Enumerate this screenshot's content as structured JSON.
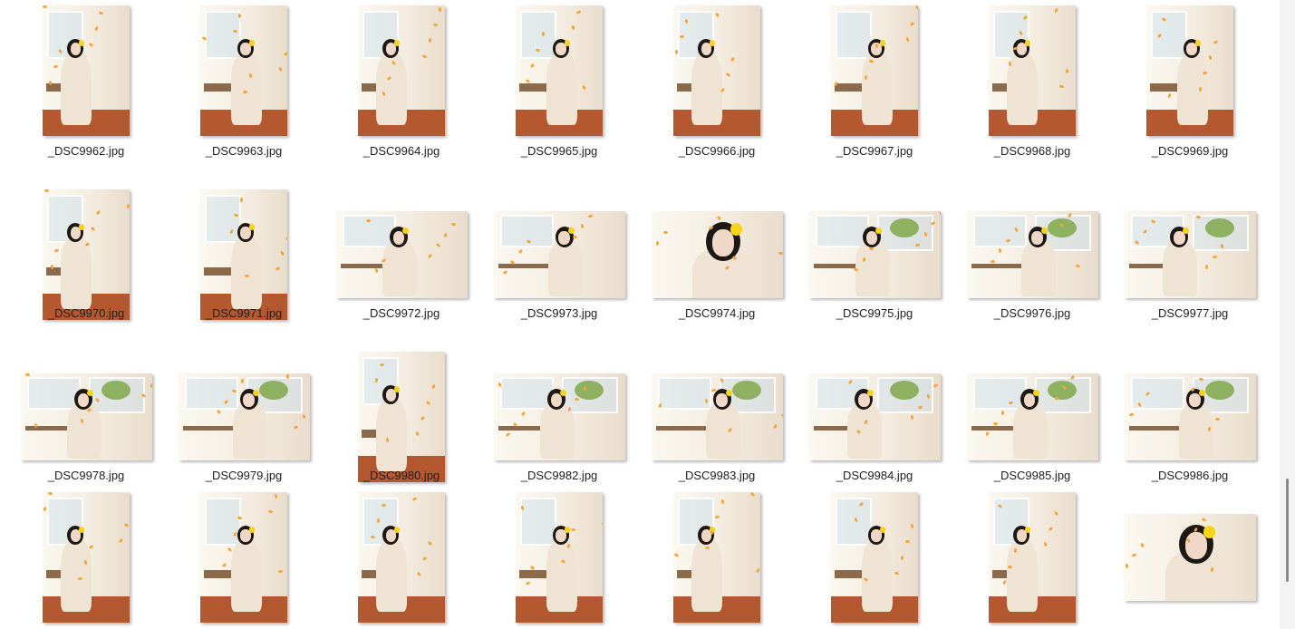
{
  "gallery": {
    "files": [
      {
        "name": "_DSC9962.jpg",
        "orientation": "portrait",
        "scene": "indoor-floor"
      },
      {
        "name": "_DSC9963.jpg",
        "orientation": "portrait",
        "scene": "window-sit"
      },
      {
        "name": "_DSC9964.jpg",
        "orientation": "portrait",
        "scene": "window-sit"
      },
      {
        "name": "_DSC9965.jpg",
        "orientation": "portrait",
        "scene": "window-sit"
      },
      {
        "name": "_DSC9966.jpg",
        "orientation": "portrait",
        "scene": "indoor-floor"
      },
      {
        "name": "_DSC9967.jpg",
        "orientation": "portrait",
        "scene": "indoor-floor"
      },
      {
        "name": "_DSC9968.jpg",
        "orientation": "portrait",
        "scene": "indoor-floor"
      },
      {
        "name": "_DSC9969.jpg",
        "orientation": "portrait",
        "scene": "indoor-floor"
      },
      {
        "name": "_DSC9970.jpg",
        "orientation": "portrait",
        "scene": "indoor-floor"
      },
      {
        "name": "_DSC9971.jpg",
        "orientation": "portrait",
        "scene": "indoor-floor"
      },
      {
        "name": "_DSC9972.jpg",
        "orientation": "landscape",
        "scene": "window-back"
      },
      {
        "name": "_DSC9973.jpg",
        "orientation": "landscape",
        "scene": "window-back"
      },
      {
        "name": "_DSC9974.jpg",
        "orientation": "landscape",
        "scene": "close-profile"
      },
      {
        "name": "_DSC9975.jpg",
        "orientation": "landscape",
        "scene": "window-plants"
      },
      {
        "name": "_DSC9976.jpg",
        "orientation": "landscape",
        "scene": "window-plants"
      },
      {
        "name": "_DSC9977.jpg",
        "orientation": "landscape",
        "scene": "window-plants"
      },
      {
        "name": "_DSC9978.jpg",
        "orientation": "landscape",
        "scene": "window-plants"
      },
      {
        "name": "_DSC9979.jpg",
        "orientation": "landscape",
        "scene": "window-plants"
      },
      {
        "name": "_DSC9980.jpg",
        "orientation": "portrait",
        "scene": "indoor-floor"
      },
      {
        "name": "_DSC9982.jpg",
        "orientation": "landscape",
        "scene": "window-wide"
      },
      {
        "name": "_DSC9983.jpg",
        "orientation": "landscape",
        "scene": "window-wide"
      },
      {
        "name": "_DSC9984.jpg",
        "orientation": "landscape",
        "scene": "window-wide"
      },
      {
        "name": "_DSC9985.jpg",
        "orientation": "landscape",
        "scene": "window-wide"
      },
      {
        "name": "_DSC9986.jpg",
        "orientation": "landscape",
        "scene": "window-wide"
      },
      {
        "name": "",
        "orientation": "portrait",
        "scene": "table-sit"
      },
      {
        "name": "",
        "orientation": "portrait",
        "scene": "table-sit"
      },
      {
        "name": "",
        "orientation": "portrait",
        "scene": "table-sit"
      },
      {
        "name": "",
        "orientation": "portrait",
        "scene": "table-sit"
      },
      {
        "name": "",
        "orientation": "portrait",
        "scene": "table-sit"
      },
      {
        "name": "",
        "orientation": "portrait",
        "scene": "table-sit"
      },
      {
        "name": "",
        "orientation": "portrait",
        "scene": "table-sit"
      },
      {
        "name": "",
        "orientation": "landscape",
        "scene": "close-profile"
      }
    ]
  },
  "colors": {
    "background": "#ffffff",
    "wall": "#f4ece0",
    "window_light": "#fbf8f0",
    "floor": "#b4582f",
    "hair": "#1e1815",
    "dress": "#efe3d3",
    "petal": "#f2a53a",
    "flower": "#f7d31c",
    "scrollbar_thumb": "#8a8a8a"
  }
}
